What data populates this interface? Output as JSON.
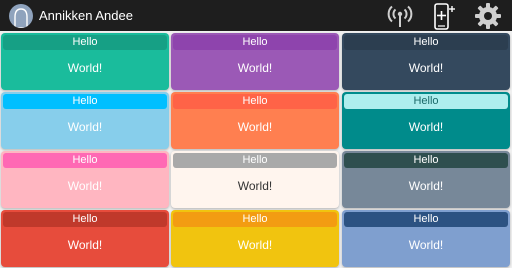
{
  "app": {
    "user_name": "Annikken Andee",
    "icons": [
      "avatar",
      "wireless-signal-icon",
      "add-device-icon",
      "settings-gear-icon"
    ]
  },
  "tiles": [
    {
      "header": "Hello",
      "body": "World!",
      "tile_color": "#1abc9c",
      "header_color": "#16a085",
      "text_color": "#ffffff"
    },
    {
      "header": "Hello",
      "body": "World!",
      "tile_color": "#9b59b6",
      "header_color": "#8e44ad",
      "text_color": "#ffffff"
    },
    {
      "header": "Hello",
      "body": "World!",
      "tile_color": "#34495e",
      "header_color": "#2c3e50",
      "text_color": "#ffffff"
    },
    {
      "header": "Hello",
      "body": "World!",
      "tile_color": "#87ceeb",
      "header_color": "#00bfff",
      "text_color": "#ffffff"
    },
    {
      "header": "Hello",
      "body": "World!",
      "tile_color": "#ff7f50",
      "header_color": "#ff6347",
      "text_color": "#ffffff"
    },
    {
      "header": "Hello",
      "body": "World!",
      "tile_color": "#008b8b",
      "header_color": "#aeeeee",
      "text_color": "#ffffff",
      "header_text_color": "#1a6a6a"
    },
    {
      "header": "Hello",
      "body": "World!",
      "tile_color": "#ffb6c1",
      "header_color": "#ff69b4",
      "text_color": "#ffffff"
    },
    {
      "header": "Hello",
      "body": "World!",
      "tile_color": "#fff5ee",
      "header_color": "#a9a9a9",
      "text_color": "#333333",
      "header_text_color": "#ffffff"
    },
    {
      "header": "Hello",
      "body": "World!",
      "tile_color": "#778899",
      "header_color": "#2f4f4f",
      "text_color": "#ffffff"
    },
    {
      "header": "Hello",
      "body": "World!",
      "tile_color": "#e74c3c",
      "header_color": "#c0392b",
      "text_color": "#ffffff"
    },
    {
      "header": "Hello",
      "body": "World!",
      "tile_color": "#f1c40f",
      "header_color": "#f39c12",
      "text_color": "#ffffff"
    },
    {
      "header": "Hello",
      "body": "World!",
      "tile_color": "#7f9fcf",
      "header_color": "#2c5282",
      "text_color": "#ffffff"
    }
  ]
}
